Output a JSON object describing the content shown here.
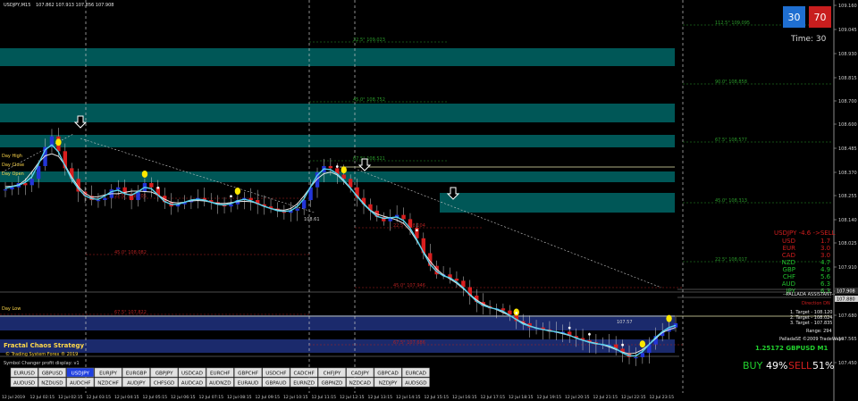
{
  "chart_data": {
    "type": "candlestick",
    "title": "USDJPY,M15",
    "ohlc_header": "107.862 107.913 107.856 107.908",
    "y_ticks": [
      "109.160",
      "109.045",
      "108.930",
      "108.815",
      "108.700",
      "108.600",
      "108.485",
      "108.370",
      "108.255",
      "108.140",
      "108.025",
      "107.910",
      "107.795",
      "107.680",
      "107.565",
      "107.450"
    ],
    "y_range": [
      107.4,
      109.2
    ],
    "price_tags": [
      "107.908",
      "107.880"
    ],
    "x_ticks": [
      "12 Jul 2019",
      "12 Jul 02:15",
      "12 Jul 02:15",
      "12 Jul 03:15",
      "12 Jul 04:15",
      "12 Jul 05:15",
      "12 Jul 06:15",
      "12 Jul 07:15",
      "12 Jul 08:15",
      "12 Jul 09:15",
      "12 Jul 10:15",
      "12 Jul 11:15",
      "12 Jul 12:15",
      "12 Jul 13:15",
      "12 Jul 14:15",
      "12 Jul 15:15",
      "12 Jul 16:15",
      "12 Jul 17:15",
      "12 Jul 18:15",
      "12 Jul 19:15",
      "12 Jul 20:15",
      "12 Jul 21:15",
      "12 Jul 22:15",
      "12 Jul 23:15"
    ],
    "price_path": [
      108.35,
      108.36,
      108.38,
      108.37,
      108.4,
      108.46,
      108.55,
      108.6,
      108.53,
      108.45,
      108.4,
      108.34,
      108.32,
      108.3,
      108.3,
      108.31,
      108.35,
      108.36,
      108.33,
      108.3,
      108.34,
      108.38,
      108.36,
      108.32,
      108.29,
      108.27,
      108.28,
      108.29,
      108.3,
      108.31,
      108.3,
      108.29,
      108.28,
      108.27,
      108.28,
      108.3,
      108.31,
      108.3,
      108.28,
      108.27,
      108.26,
      108.25,
      108.24,
      108.25,
      108.26,
      108.3,
      108.36,
      108.43,
      108.46,
      108.45,
      108.42,
      108.4,
      108.36,
      108.31,
      108.28,
      108.25,
      108.22,
      108.2,
      108.22,
      108.23,
      108.21,
      108.17,
      108.12,
      108.05,
      107.99,
      107.95,
      107.95,
      107.93,
      107.92,
      107.89,
      107.85,
      107.82,
      107.8,
      107.79,
      107.79,
      107.78,
      107.76,
      107.73,
      107.72,
      107.7,
      107.7,
      107.69,
      107.68,
      107.68,
      107.68,
      107.66,
      107.65,
      107.64,
      107.63,
      107.62,
      107.62,
      107.62,
      107.6,
      107.58,
      107.56,
      107.56,
      107.58,
      107.62,
      107.66,
      107.68,
      107.7,
      107.72
    ],
    "fib_levels": [
      {
        "label": "112.5° 109.095",
        "price": 109.095
      },
      {
        "label": "90.0° 108.858",
        "price": 108.858
      },
      {
        "label": "67.5° 108.577",
        "price": 108.577
      },
      {
        "label": "45.0° 108.313",
        "price": 108.313
      },
      {
        "label": "22.5° 108.017",
        "price": 108.017
      },
      {
        "label": "22.5° 109.023",
        "price": 109.023
      },
      {
        "label": "45.0° 108.752",
        "price": 108.752
      },
      {
        "label": "67.5° 108.521",
        "price": 108.521
      },
      {
        "label": "22.5° 108.205",
        "price": 108.205
      },
      {
        "label": "45.0° 108.082",
        "price": 108.082
      },
      {
        "label": "22.5° 108.104",
        "price": 108.104
      },
      {
        "label": "45.0° 107.946",
        "price": 107.946
      },
      {
        "label": "67.5° 107.822",
        "price": 107.822
      },
      {
        "label": "67.5° 107.686",
        "price": 107.686
      }
    ],
    "annotations": [
      "108.61",
      "107.57"
    ],
    "left_labels": [
      "Day High",
      "Day Close",
      "Day Open",
      "Day Low"
    ]
  },
  "header": {
    "symbol": "USDJPY,M15",
    "ohlc": "107.862 107.913 107.856 107.908"
  },
  "timer": {
    "blue_value": "30",
    "red_value": "70",
    "time_label": "Time: 30",
    "blue_color": "#1f6fd1",
    "red_color": "#c81e1e"
  },
  "strength": {
    "title": "USDJPY -4.6 ->SELL",
    "items": [
      {
        "cur": "USD",
        "val": "1.7",
        "color": "#d21e1e"
      },
      {
        "cur": "EUR",
        "val": "3.0",
        "color": "#d21e1e"
      },
      {
        "cur": "CAD",
        "val": "3.0",
        "color": "#d21e1e"
      },
      {
        "cur": "NZD",
        "val": "4.7",
        "color": "#22c22e"
      },
      {
        "cur": "GBP",
        "val": "4.9",
        "color": "#22c22e"
      },
      {
        "cur": "CHF",
        "val": "5.6",
        "color": "#22c22e"
      },
      {
        "cur": "AUD",
        "val": "6.3",
        "color": "#22c22e"
      },
      {
        "cur": "JPY",
        "val": "6.3",
        "color": "#22c22e"
      }
    ]
  },
  "assistant": {
    "title": "--PALLADA ASSISTANT--",
    "direction": "Direction DN",
    "targets": [
      "1. Target - 108.120",
      "2. Target - 108.024",
      "3. Target - 107.835"
    ],
    "range": "Range: 294",
    "copyright": "PalladaSE ©2009 TradeWays",
    "quote": "1.25172 GBPUSD M1"
  },
  "buy_sell": {
    "buy_label": "BUY",
    "buy_pct": "49%",
    "sell_label": "SELL",
    "sell_pct": "51%"
  },
  "strategy": {
    "title": "Fractal Chaos Strategy",
    "subtitle": "© Trading System Forex ® 2019"
  },
  "symbol_changer": {
    "title": "Symbol Changer profit display: v1",
    "active": "USDJPY",
    "rows": [
      [
        "EURUSD",
        "GBPUSD",
        "USDJPY",
        "EURJPY",
        "EURGBP",
        "GBPJPY",
        "USDCAD",
        "EURCHF",
        "GBPCHF",
        "USDCHF",
        "CADCHF",
        "CHFJPY",
        "CADJPY",
        "GBPCAD",
        "EURCAD"
      ],
      [
        "AUDUSD",
        "NZDUSD",
        "AUDCHF",
        "NZDCHF",
        "AUDJPY",
        "CHFSGD",
        "AUDCAD",
        "AUDNZD",
        "EURAUD",
        "GBPAUD",
        "EURNZD",
        "GBPNZD",
        "NZDCAD",
        "NZDJPY",
        "AUDSGD"
      ]
    ]
  },
  "colors": {
    "zone_teal": "#006060",
    "zone_navy": "#1e2f78",
    "ma_cyan": "#5ad4ee",
    "ma_white": "#e8e8e8",
    "bull": "#2235d8",
    "bear": "#d81e1e",
    "fib_green": "#2a9a2a",
    "fib_red": "#b02020",
    "yellow_dot": "#ffe800"
  }
}
